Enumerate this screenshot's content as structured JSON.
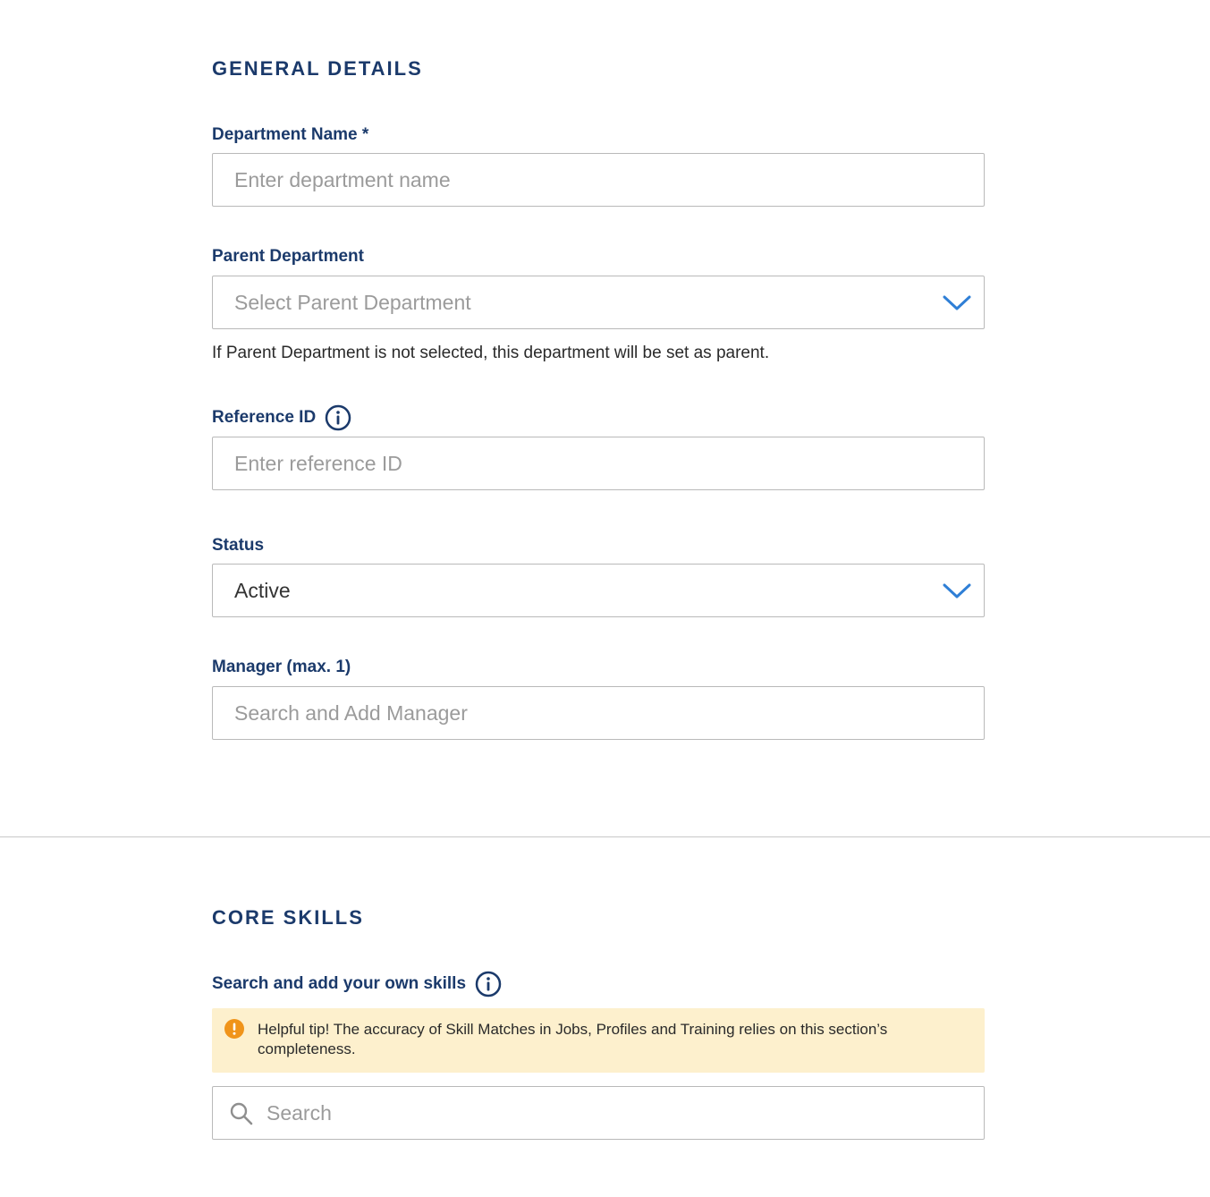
{
  "general": {
    "title": "GENERAL DETAILS",
    "department_name": {
      "label": "Department Name *",
      "placeholder": "Enter department name"
    },
    "parent_department": {
      "label": "Parent Department",
      "placeholder": "Select Parent Department",
      "help": "If Parent Department is not selected, this department will be set as parent."
    },
    "reference_id": {
      "label": "Reference ID",
      "placeholder": "Enter reference ID"
    },
    "status": {
      "label": "Status",
      "value": "Active"
    },
    "manager": {
      "label": "Manager (max. 1)",
      "placeholder": "Search and Add Manager"
    }
  },
  "core_skills": {
    "title": "CORE SKILLS",
    "search_label": "Search and add your own skills",
    "tip": "Helpful tip! The accuracy of Skill Matches in Jobs, Profiles and Training relies on this section’s completeness.",
    "search_placeholder": "Search"
  },
  "colors": {
    "heading": "#1b3a6b",
    "accent": "#2f7fd6",
    "tip_background": "#fdf0cd",
    "warning": "#f0941a"
  },
  "icons": {
    "info": "info-icon",
    "dropdown": "chevron-down-icon",
    "warning": "warning-icon",
    "search": "search-icon"
  }
}
